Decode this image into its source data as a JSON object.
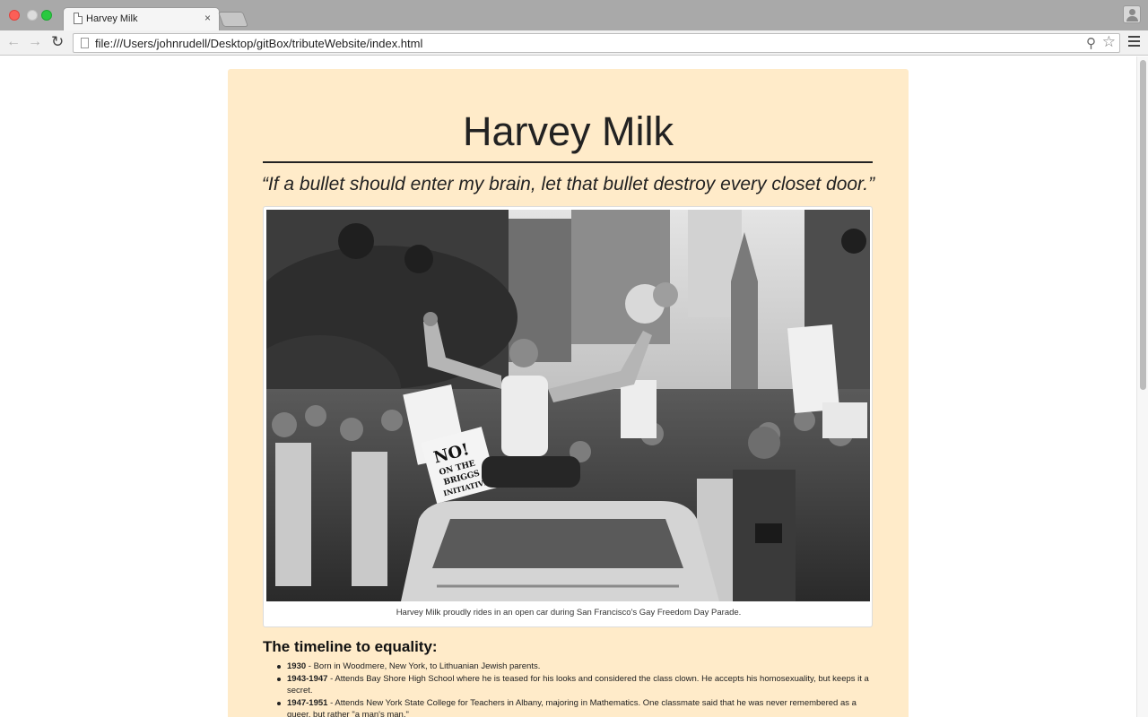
{
  "browser": {
    "tab_title": "Harvey Milk",
    "tab_close": "×",
    "url": "file:///Users/johnrudell/Desktop/gitBox/tributeWebsite/index.html",
    "back": "←",
    "forward": "→",
    "reload": "↻",
    "search_icon": "search-icon",
    "star_icon": "star-icon",
    "menu_icon": "hamburger-menu-icon"
  },
  "page": {
    "title": "Harvey Milk",
    "quote": "“If a bullet should enter my brain, let that bullet destroy every closet door.”",
    "figure": {
      "caption": "Harvey Milk proudly rides in an open car during San Francisco's Gay Freedom Day Parade.",
      "sign_text": [
        "NO!",
        "ON THE",
        "BRIGGS",
        "INITIATIVE"
      ]
    },
    "timeline_heading": "The timeline to equality:",
    "timeline": [
      {
        "year": "1930",
        "text": " - Born in Woodmere, New York, to Lithuanian Jewish parents."
      },
      {
        "year": "1943-1947",
        "text": " - Attends Bay Shore High School where he is teased for his looks and considered the class clown. He accepts his homosexuality, but keeps it a secret."
      },
      {
        "year": "1947-1951",
        "text": " - Attends New York State College for Teachers in Albany, majoring in Mathematics. One classmate said that he was never remembered as a queer, but rather \"a man's man.\""
      }
    ]
  },
  "colors": {
    "main_background": "#ffebc9",
    "tabbar": "#a9a9a9"
  }
}
